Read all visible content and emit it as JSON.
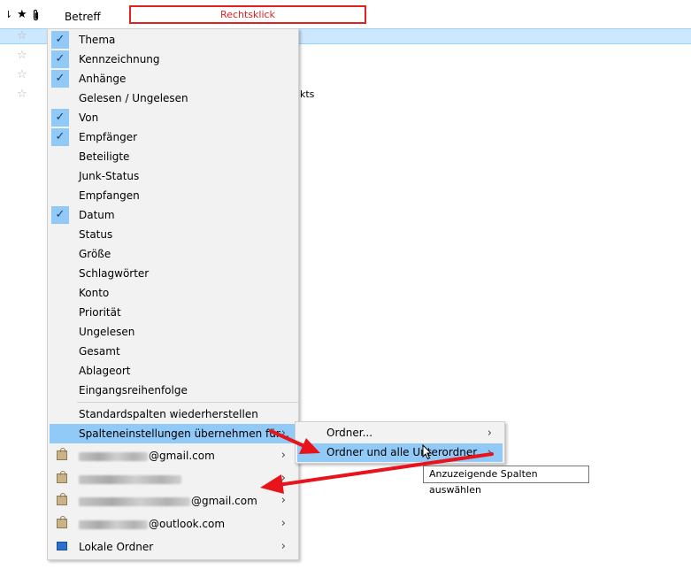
{
  "header": {
    "thread_icon": "⇂",
    "star_icon": "★",
    "attachment_icon": "📎",
    "subject_label": "Betreff",
    "annotation": "Rechtsklick"
  },
  "background": {
    "row_star": "☆",
    "partial_text": "kts"
  },
  "context_menu": {
    "items": [
      {
        "label": "Thema",
        "checked": true
      },
      {
        "label": "Kennzeichnung",
        "checked": true
      },
      {
        "label": "Anhänge",
        "checked": true
      },
      {
        "label": "Gelesen / Ungelesen",
        "checked": false
      },
      {
        "label": "Von",
        "checked": true
      },
      {
        "label": "Empfänger",
        "checked": true
      },
      {
        "label": "Beteiligte",
        "checked": false
      },
      {
        "label": "Junk-Status",
        "checked": false
      },
      {
        "label": "Empfangen",
        "checked": false
      },
      {
        "label": "Datum",
        "checked": true
      },
      {
        "label": "Status",
        "checked": false
      },
      {
        "label": "Größe",
        "checked": false
      },
      {
        "label": "Schlagwörter",
        "checked": false
      },
      {
        "label": "Konto",
        "checked": false
      },
      {
        "label": "Priorität",
        "checked": false
      },
      {
        "label": "Ungelesen",
        "checked": false
      },
      {
        "label": "Gesamt",
        "checked": false
      },
      {
        "label": "Ablageort",
        "checked": false
      },
      {
        "label": "Eingangsreihenfolge",
        "checked": false
      }
    ],
    "check_glyph": "✓",
    "restore_defaults": "Standardspalten wiederherstellen",
    "apply_to": "Spalteneinstellungen übernehmen für...",
    "accounts": [
      {
        "label": "@gmail.com"
      },
      {
        "label": ""
      },
      {
        "label": "@gmail.com"
      },
      {
        "label": "@outlook.com"
      }
    ],
    "local_folders": "Lokale Ordner",
    "submenu_arrow": "›"
  },
  "submenu": {
    "items": [
      {
        "label": "Ordner..."
      },
      {
        "label": "Ordner und alle Unterordner..."
      }
    ]
  },
  "tooltip": "Anzuzeigende Spalten auswählen",
  "colors": {
    "highlight": "#91c9f7",
    "annotation": "#e02222",
    "selected_row": "#cce8ff"
  }
}
